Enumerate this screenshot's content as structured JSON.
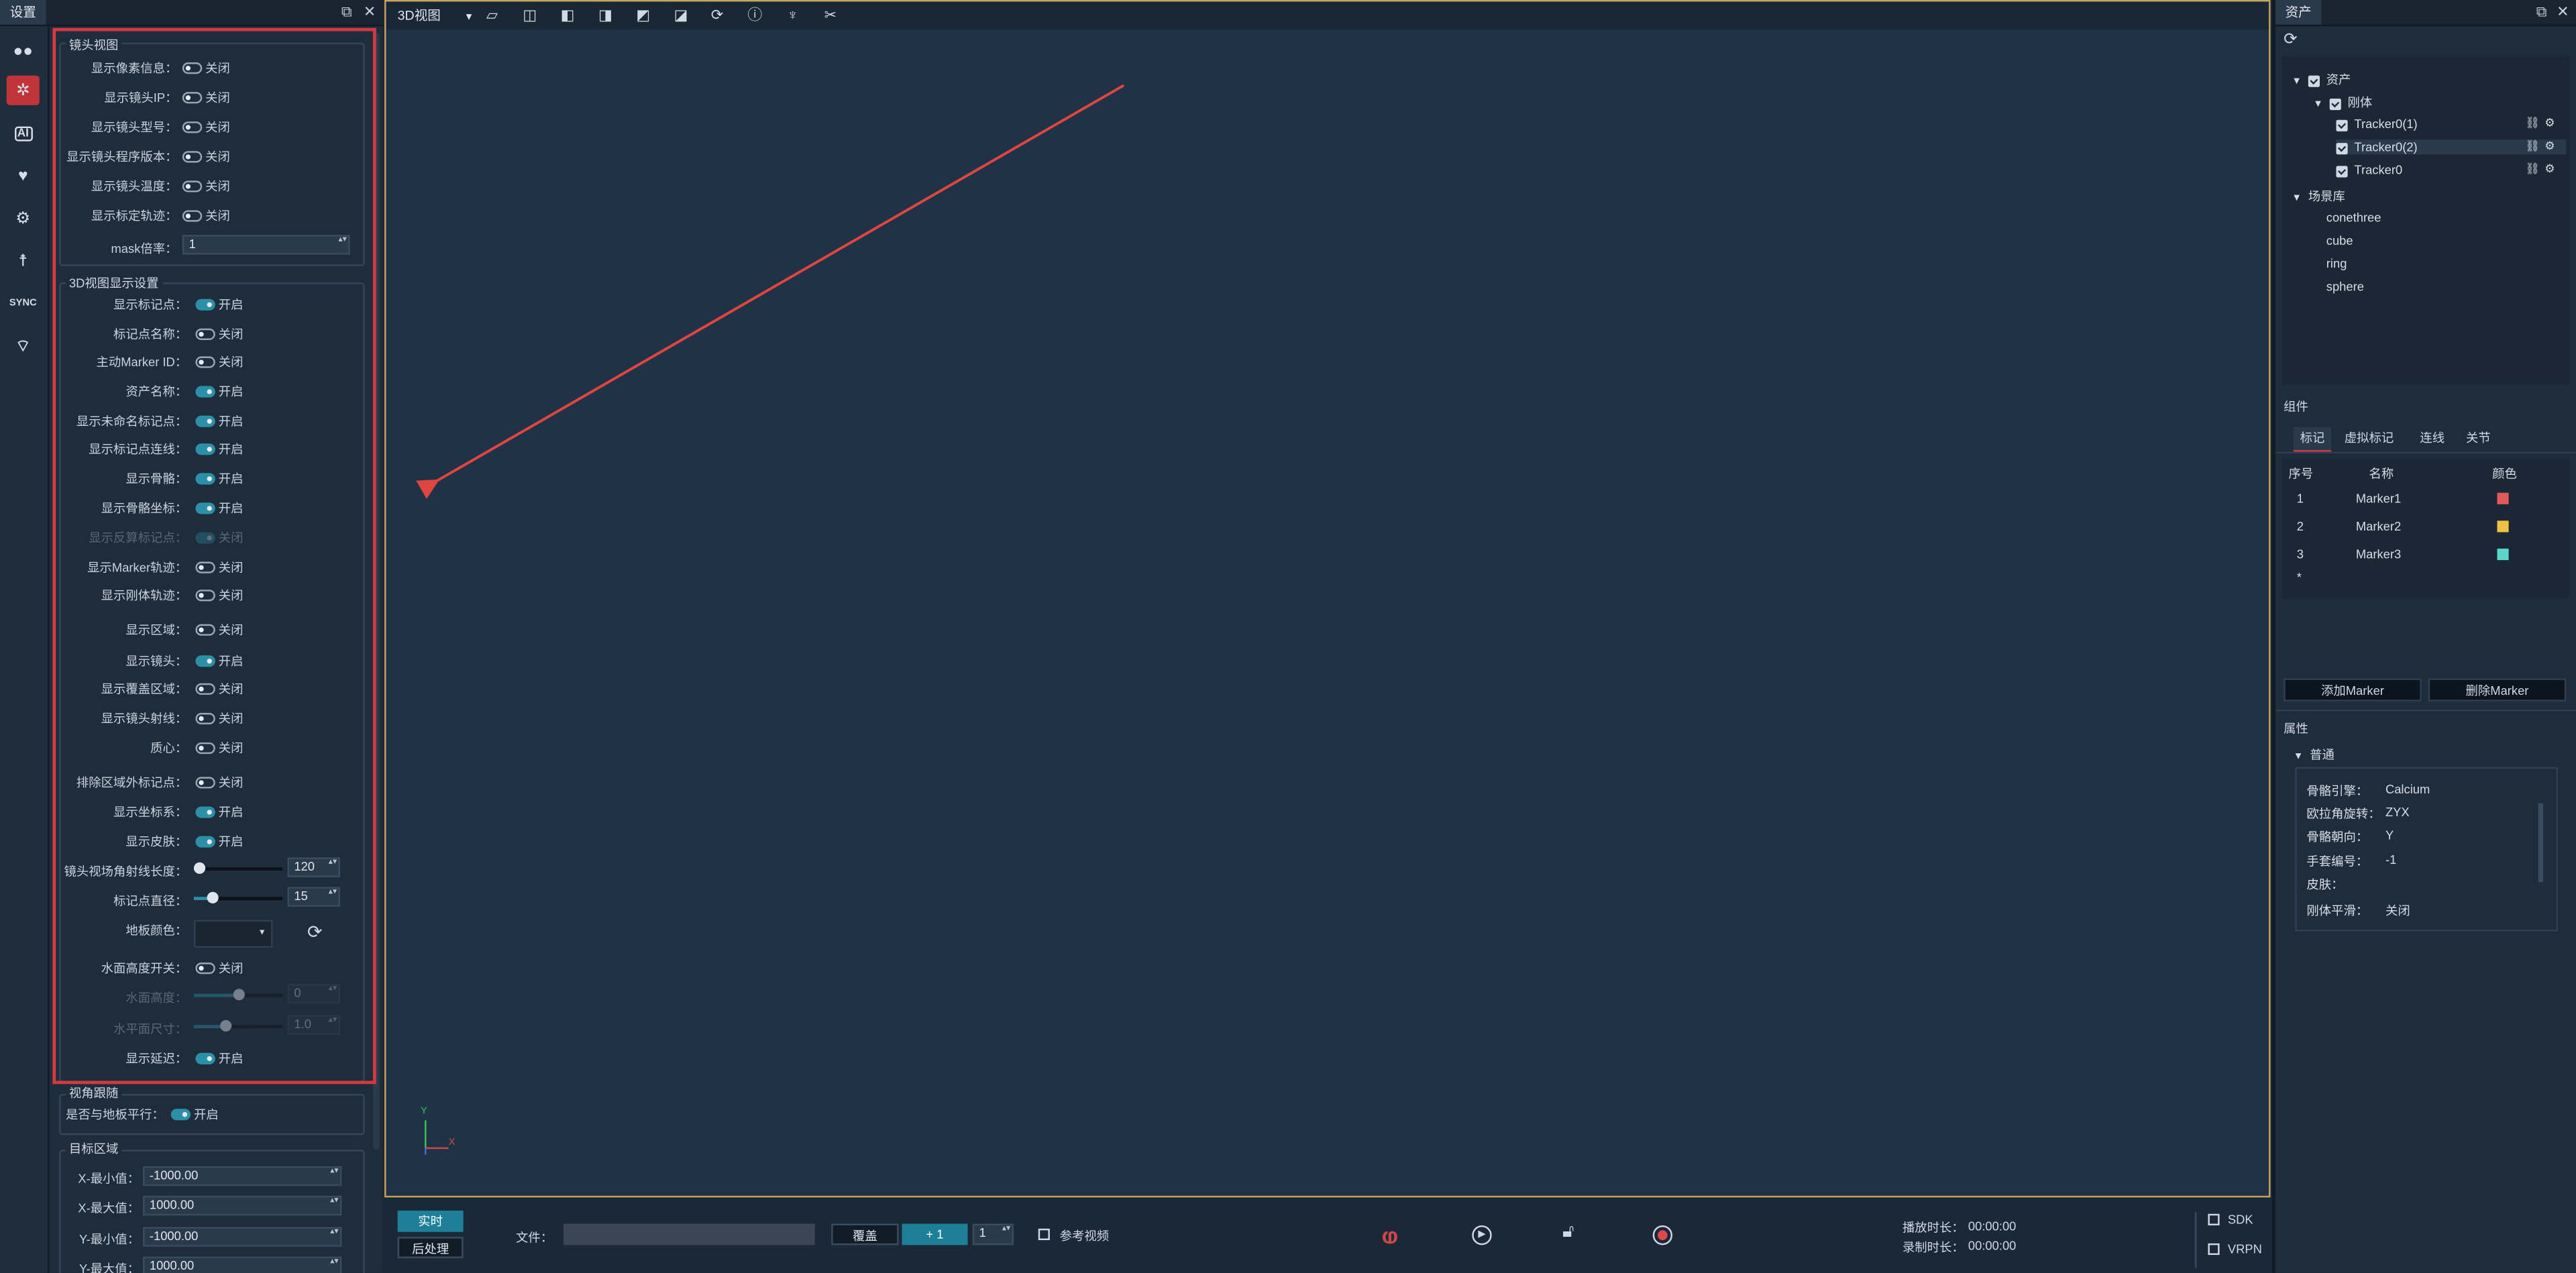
{
  "left_panel": {
    "title": "设置",
    "camera_view": {
      "title": "镜头视图",
      "rows": [
        {
          "label": "显示像素信息：",
          "state": "关闭",
          "on": false
        },
        {
          "label": "显示镜头IP：",
          "state": "关闭",
          "on": false
        },
        {
          "label": "显示镜头型号：",
          "state": "关闭",
          "on": false
        },
        {
          "label": "显示镜头程序版本：",
          "state": "关闭",
          "on": false
        },
        {
          "label": "显示镜头温度：",
          "state": "关闭",
          "on": false
        },
        {
          "label": "显示标定轨迹：",
          "state": "关闭",
          "on": false
        }
      ],
      "mask_label": "mask倍率：",
      "mask_value": "1"
    },
    "view3d": {
      "title": "3D视图显示设置",
      "rows": [
        {
          "label": "显示标记点：",
          "state": "开启",
          "on": true
        },
        {
          "label": "标记点名称：",
          "state": "关闭",
          "on": false
        },
        {
          "label": "主动Marker ID：",
          "state": "关闭",
          "on": false
        },
        {
          "label": "资产名称：",
          "state": "开启",
          "on": true
        },
        {
          "label": "显示未命名标记点：",
          "state": "开启",
          "on": true
        },
        {
          "label": "显示标记点连线：",
          "state": "开启",
          "on": true
        },
        {
          "label": "显示骨骼：",
          "state": "开启",
          "on": true
        },
        {
          "label": "显示骨骼坐标：",
          "state": "开启",
          "on": true
        },
        {
          "label": "显示反算标记点：",
          "state": "关闭",
          "on": true,
          "disabled": true
        },
        {
          "label": "显示Marker轨迹：",
          "state": "关闭",
          "on": false
        },
        {
          "label": "显示刚体轨迹：",
          "state": "关闭",
          "on": false
        },
        {
          "label": "显示区域：",
          "state": "关闭",
          "on": false
        },
        {
          "label": "显示镜头：",
          "state": "开启",
          "on": true
        },
        {
          "label": "显示覆盖区域：",
          "state": "关闭",
          "on": false
        },
        {
          "label": "显示镜头射线：",
          "state": "关闭",
          "on": false
        },
        {
          "label": "质心：",
          "state": "关闭",
          "on": false
        },
        {
          "label": "排除区域外标记点：",
          "state": "关闭",
          "on": false
        },
        {
          "label": "显示坐标系：",
          "state": "开启",
          "on": true
        },
        {
          "label": "显示皮肤：",
          "state": "开启",
          "on": true
        }
      ],
      "ray_length_label": "镜头视场角射线长度：",
      "ray_length_value": "120",
      "ray_length_fraction": 0.05,
      "marker_diameter_label": "标记点直径：",
      "marker_diameter_value": "15",
      "marker_diameter_fraction": 0.2,
      "floor_color_label": "地板颜色：",
      "water_toggle_label": "水面高度开关：",
      "water_toggle_state": "关闭",
      "water_height_label": "水面高度：",
      "water_height_value": "0",
      "water_height_fraction": 0.5,
      "horizontal_size_label": "水平面尺寸：",
      "horizontal_size_value": "1.0",
      "horizontal_size_fraction": 0.35,
      "show_latency_label": "显示延迟：",
      "show_latency_state": "开启"
    },
    "follow": {
      "title": "视角跟随",
      "parallel_label": "是否与地板平行：",
      "parallel_state": "开启"
    },
    "target": {
      "title": "目标区域",
      "xmin_label": "X-最小值：",
      "xmin": "-1000.00",
      "xmax_label": "X-最大值：",
      "xmax": "1000.00",
      "ymin_label": "Y-最小值：",
      "ymin": "-1000.00",
      "ymax_label": "Y-最大值：",
      "ymax": "1000.00"
    }
  },
  "nav_icons": [
    "camera-icon",
    "skeleton-icon",
    "ai-icon",
    "heart-icon",
    "gear-icon",
    "person-icon",
    "sync-icon",
    "wireless-icon"
  ],
  "viewport": {
    "view_label": "3D视图",
    "axis_y": "Y",
    "axis_x": "X"
  },
  "bottom": {
    "realtime": "实时",
    "postprocess": "后处理",
    "file_label": "文件：",
    "overwrite": "覆盖",
    "plus_one": "+ 1",
    "count": "1",
    "reference_video": "参考视频",
    "play_time_label": "播放时长：",
    "play_time": "00:00:00",
    "record_time_label": "录制时长：",
    "record_time": "00:00:00",
    "sdk": "SDK",
    "vrpn": "VRPN"
  },
  "right_panel": {
    "title": "资产",
    "tree": {
      "root": "资产",
      "rigid": "刚体",
      "items": [
        "Tracker0(1)",
        "Tracker0(2)",
        "Tracker0"
      ],
      "scene_lib": "场景库",
      "scene_items": [
        "conethree",
        "cube",
        "ring",
        "sphere"
      ]
    },
    "components_title": "组件",
    "tabs": [
      "标记",
      "虚拟标记",
      "连线",
      "关节"
    ],
    "table_headers": [
      "序号",
      "名称",
      "颜色"
    ],
    "markers": [
      {
        "id": "1",
        "name": "Marker1",
        "color": "#e05a5a"
      },
      {
        "id": "2",
        "name": "Marker2",
        "color": "#f0c040"
      },
      {
        "id": "3",
        "name": "Marker3",
        "color": "#5ad6c8"
      }
    ],
    "new_row_marker": "*",
    "add_marker": "添加Marker",
    "delete_marker": "删除Marker",
    "properties_title": "属性",
    "general": "普通",
    "props": [
      {
        "key": "骨骼引擎：",
        "value": "Calcium"
      },
      {
        "key": "欧拉角旋转：",
        "value": "ZYX"
      },
      {
        "key": "骨骼朝向：",
        "value": "Y"
      },
      {
        "key": "手套编号：",
        "value": "-1"
      },
      {
        "key": "皮肤：",
        "value": ""
      },
      {
        "key": "刚体平滑：",
        "value": "关闭"
      }
    ]
  }
}
